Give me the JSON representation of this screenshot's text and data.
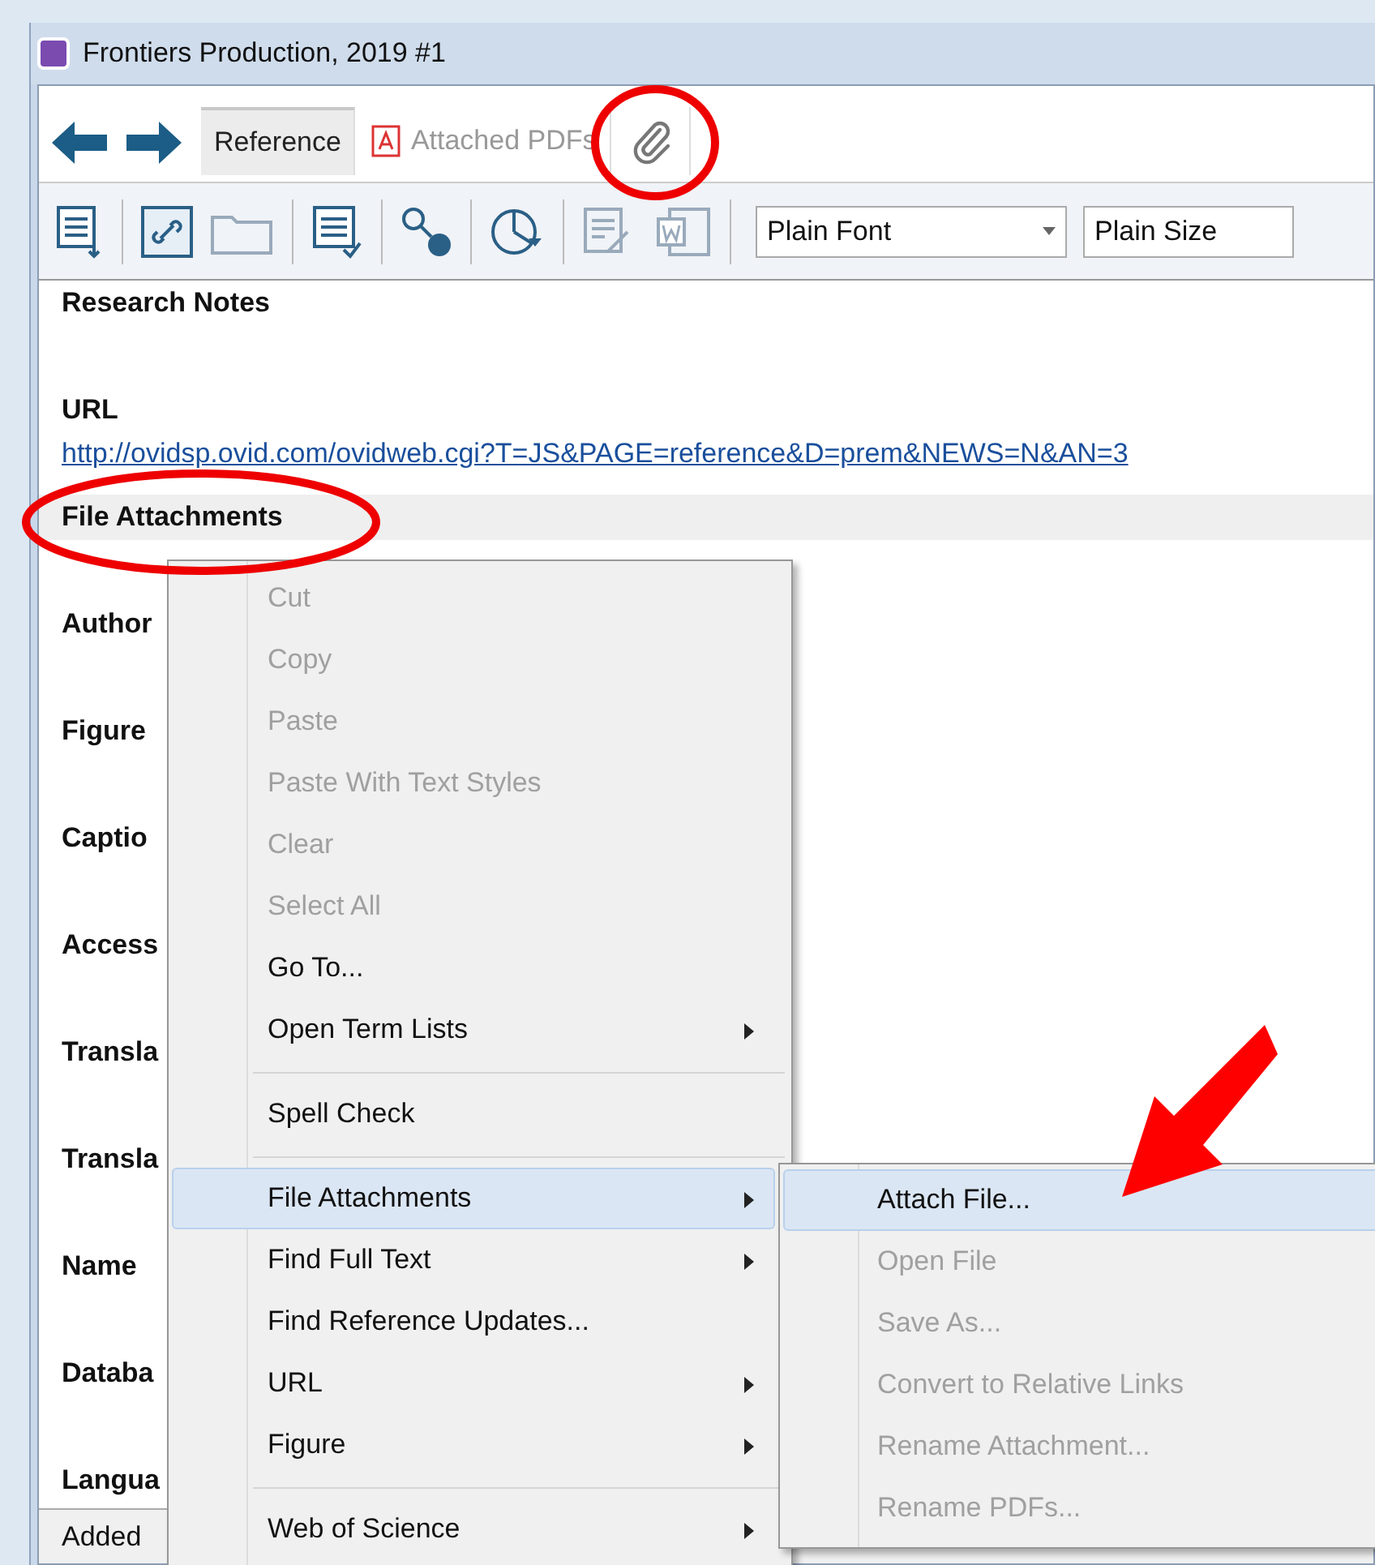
{
  "window": {
    "title": "Frontiers Production, 2019 #1"
  },
  "tabs": [
    {
      "kind": "text",
      "label": "Reference",
      "selected": true
    },
    {
      "kind": "pdf",
      "label": "Attached PDFs",
      "selected": false
    },
    {
      "kind": "attachment",
      "selected": false
    }
  ],
  "toolbar": {
    "font_select": "Plain Font",
    "size_select": "Plain Size"
  },
  "fields": [
    {
      "label": "Research Notes",
      "selected": false
    },
    {
      "label": "URL",
      "value": "http://ovidsp.ovid.com/ovidweb.cgi?T=JS&PAGE=reference&D=prem&NEWS=N&AN=3",
      "selected": false
    },
    {
      "label": "File Attachments",
      "selected": true
    },
    {
      "label": "Author",
      "selected": false
    },
    {
      "label": "Figure",
      "selected": false
    },
    {
      "label": "Captio",
      "selected": false
    },
    {
      "label": "Access",
      "selected": false
    },
    {
      "label": "Transla",
      "selected": false
    },
    {
      "label": "Transla",
      "selected": false
    },
    {
      "label": "Name",
      "selected": false
    },
    {
      "label": "Databa",
      "selected": false
    },
    {
      "label": "Langua",
      "selected": false
    }
  ],
  "status_bar": {
    "text": "Added"
  },
  "context_menu": {
    "items": [
      {
        "kind": "item",
        "label": "Cut",
        "disabled": true,
        "submenu": false,
        "selected": false
      },
      {
        "kind": "item",
        "label": "Copy",
        "disabled": true,
        "submenu": false,
        "selected": false
      },
      {
        "kind": "item",
        "label": "Paste",
        "disabled": true,
        "submenu": false,
        "selected": false
      },
      {
        "kind": "item",
        "label": "Paste With Text Styles",
        "disabled": true,
        "submenu": false,
        "selected": false
      },
      {
        "kind": "item",
        "label": "Clear",
        "disabled": true,
        "submenu": false,
        "selected": false
      },
      {
        "kind": "item",
        "label": "Select All",
        "disabled": true,
        "submenu": false,
        "selected": false
      },
      {
        "kind": "item",
        "label": "Go To...",
        "disabled": false,
        "submenu": false,
        "selected": false
      },
      {
        "kind": "item",
        "label": "Open Term Lists",
        "disabled": false,
        "submenu": true,
        "selected": false
      },
      {
        "kind": "separator"
      },
      {
        "kind": "item",
        "label": "Spell Check",
        "disabled": false,
        "submenu": false,
        "selected": false
      },
      {
        "kind": "separator"
      },
      {
        "kind": "item",
        "label": "File Attachments",
        "disabled": false,
        "submenu": true,
        "selected": true
      },
      {
        "kind": "item",
        "label": "Find Full Text",
        "disabled": false,
        "submenu": true,
        "selected": false
      },
      {
        "kind": "item",
        "label": "Find Reference Updates...",
        "disabled": false,
        "submenu": false,
        "selected": false
      },
      {
        "kind": "item",
        "label": "URL",
        "disabled": false,
        "submenu": true,
        "selected": false
      },
      {
        "kind": "item",
        "label": "Figure",
        "disabled": false,
        "submenu": true,
        "selected": false
      },
      {
        "kind": "separator"
      },
      {
        "kind": "item",
        "label": "Web of Science",
        "disabled": false,
        "submenu": true,
        "selected": false
      }
    ]
  },
  "submenu": {
    "items": [
      {
        "label": "Attach File...",
        "disabled": false,
        "selected": true
      },
      {
        "label": "Open File",
        "disabled": true,
        "selected": false
      },
      {
        "label": "Save As...",
        "disabled": true,
        "selected": false
      },
      {
        "label": "Convert to Relative Links",
        "disabled": true,
        "selected": false
      },
      {
        "label": "Rename Attachment...",
        "disabled": true,
        "selected": false
      },
      {
        "label": "Rename PDFs...",
        "disabled": true,
        "selected": false
      }
    ]
  }
}
